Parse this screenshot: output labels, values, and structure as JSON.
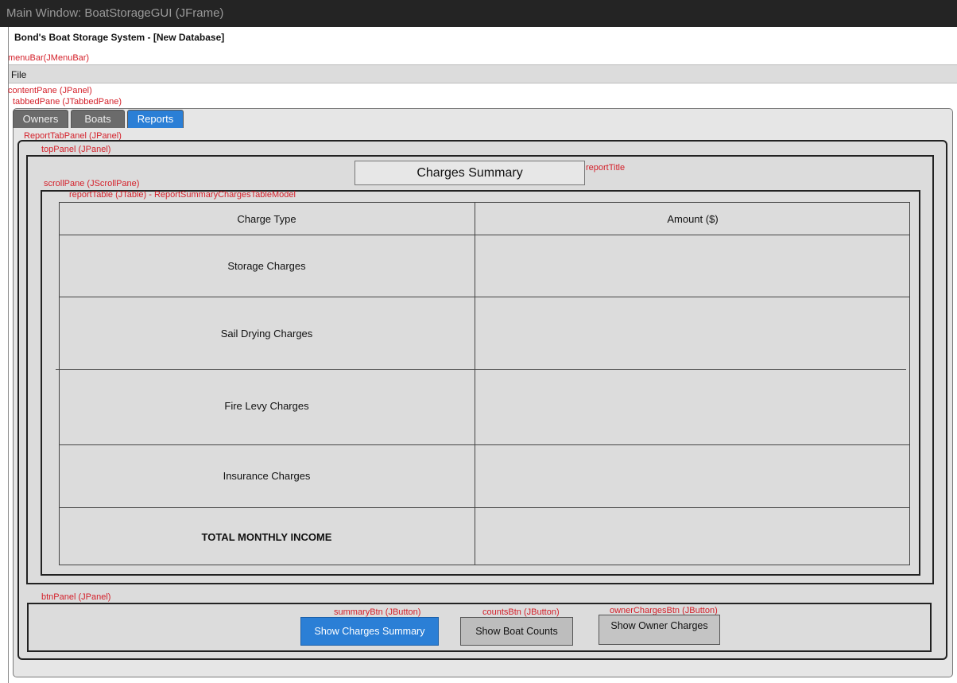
{
  "window": {
    "titlebar": "Main Window: BoatStorageGUI (JFrame)",
    "app_title": "Bond's Boat Storage System - [New Database]"
  },
  "menu": {
    "items": [
      "File"
    ]
  },
  "annotations": {
    "menubar": "menuBar(JMenuBar)",
    "contentpane": "contentPane (JPanel)",
    "tabbedpane": "tabbedPane (JTabbedPane)",
    "reporttabpanel": "ReportTabPanel (JPanel)",
    "toppanel": "topPanel (JPanel)",
    "reporttitle": "reportTitle",
    "scrollpane": "scrollPane (JScrollPane)",
    "reporttable": "reportTable (JTable) - ReportSummaryChargesTableModel",
    "btnpanel": "btnPanel (JPanel)",
    "summarybtn": "summaryBtn (JButton)",
    "countsbtn": "countsBtn (JButton)",
    "ownerchargesbtn": "ownerChargesBtn (JButton)"
  },
  "tabs": [
    {
      "label": "Owners",
      "active": false
    },
    {
      "label": "Boats",
      "active": false
    },
    {
      "label": "Reports",
      "active": true
    }
  ],
  "report": {
    "title": "Charges Summary",
    "columns": [
      "Charge Type",
      "Amount ($)"
    ],
    "rows": [
      {
        "label": "Storage Charges",
        "amount": ""
      },
      {
        "label": "Sail Drying Charges",
        "amount": ""
      },
      {
        "label": "Fire Levy Charges",
        "amount": ""
      },
      {
        "label": "Insurance Charges",
        "amount": ""
      },
      {
        "label": "TOTAL MONTHLY INCOME",
        "amount": "",
        "bold": true
      }
    ]
  },
  "buttons": {
    "summary": "Show Charges Summary",
    "counts": "Show Boat Counts",
    "owner_charges": "Show Owner Charges"
  },
  "colors": {
    "accent": "#2b7fd6",
    "annotation": "#d4202a",
    "panel": "#dcdcdc",
    "titlebar": "#242424"
  }
}
